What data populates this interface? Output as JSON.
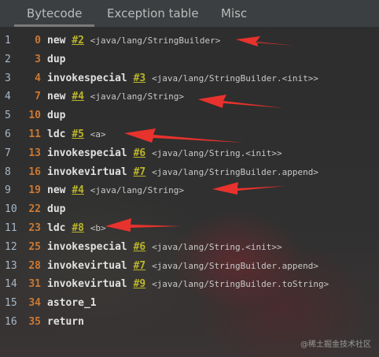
{
  "tabs": [
    {
      "label": "Bytecode",
      "active": true
    },
    {
      "label": "Exception table",
      "active": false
    },
    {
      "label": "Misc",
      "active": false
    }
  ],
  "lines": [
    {
      "n": "1",
      "off": "0",
      "op": "new",
      "ref": "#2",
      "comment": "<java/lang/StringBuilder>"
    },
    {
      "n": "2",
      "off": "3",
      "op": "dup",
      "ref": "",
      "comment": ""
    },
    {
      "n": "3",
      "off": "4",
      "op": "invokespecial",
      "ref": "#3",
      "comment": "<java/lang/StringBuilder.<init>>"
    },
    {
      "n": "4",
      "off": "7",
      "op": "new",
      "ref": "#4",
      "comment": "<java/lang/String>"
    },
    {
      "n": "5",
      "off": "10",
      "op": "dup",
      "ref": "",
      "comment": ""
    },
    {
      "n": "6",
      "off": "11",
      "op": "ldc",
      "ref": "#5",
      "comment": "<a>"
    },
    {
      "n": "7",
      "off": "13",
      "op": "invokespecial",
      "ref": "#6",
      "comment": "<java/lang/String.<init>>"
    },
    {
      "n": "8",
      "off": "16",
      "op": "invokevirtual",
      "ref": "#7",
      "comment": "<java/lang/StringBuilder.append>"
    },
    {
      "n": "9",
      "off": "19",
      "op": "new",
      "ref": "#4",
      "comment": "<java/lang/String>"
    },
    {
      "n": "10",
      "off": "22",
      "op": "dup",
      "ref": "",
      "comment": ""
    },
    {
      "n": "11",
      "off": "23",
      "op": "ldc",
      "ref": "#8",
      "comment": "<b>"
    },
    {
      "n": "12",
      "off": "25",
      "op": "invokespecial",
      "ref": "#6",
      "comment": "<java/lang/String.<init>>"
    },
    {
      "n": "13",
      "off": "28",
      "op": "invokevirtual",
      "ref": "#7",
      "comment": "<java/lang/StringBuilder.append>"
    },
    {
      "n": "14",
      "off": "31",
      "op": "invokevirtual",
      "ref": "#9",
      "comment": "<java/lang/StringBuilder.toString>"
    },
    {
      "n": "15",
      "off": "34",
      "op": "astore_1",
      "ref": "",
      "comment": ""
    },
    {
      "n": "16",
      "off": "35",
      "op": "return",
      "ref": "",
      "comment": ""
    }
  ],
  "annotation_color": "#e8322d",
  "watermark": "@稀土掘金技术社区"
}
